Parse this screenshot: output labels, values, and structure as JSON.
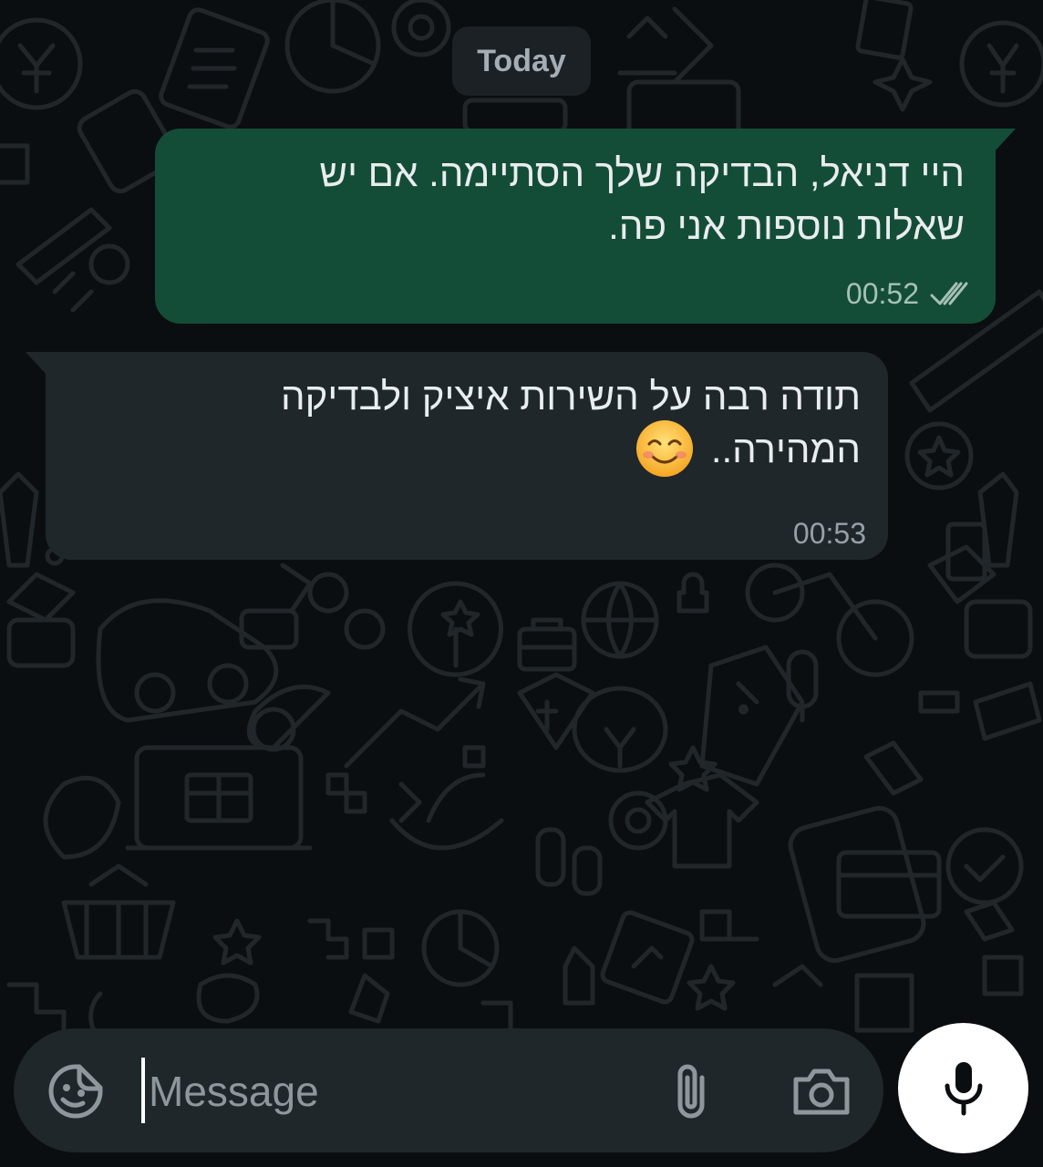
{
  "date_separator": "Today",
  "messages": [
    {
      "direction": "outgoing",
      "lines": [
        "היי דניאל, הבדיקה שלך הסתיימה. אם יש",
        "שאלות נוספות אני פה."
      ],
      "time": "00:52",
      "status": "read-double-check-icon"
    },
    {
      "direction": "incoming",
      "lines": [
        "תודה רבה על השירות איציק ולבדיקה",
        "המהירה.."
      ],
      "emoji": "smiling-face-with-smiling-eyes",
      "time": "00:53"
    }
  ],
  "composer": {
    "placeholder": "Message",
    "value": "",
    "icons": [
      "sticker-icon",
      "paperclip-icon",
      "camera-icon",
      "microphone-icon"
    ]
  },
  "colors": {
    "background": "#0b0e10",
    "outgoing_bubble": "#144d37",
    "incoming_bubble": "#1f272b",
    "input_bar": "#1f272b",
    "mic_button": "#ffffff"
  }
}
